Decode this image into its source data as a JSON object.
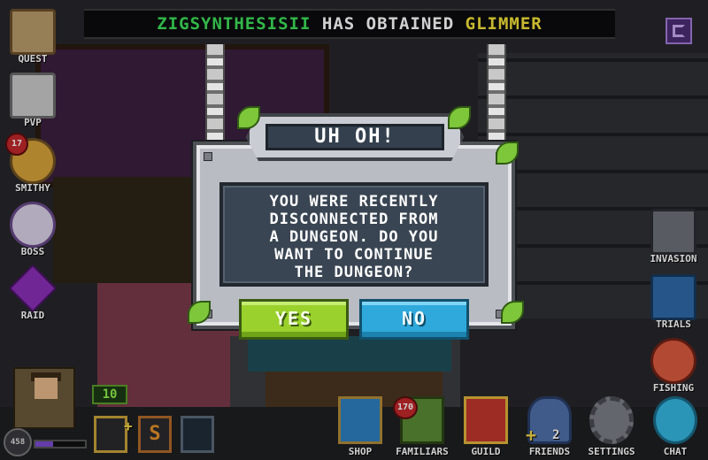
{
  "banner": {
    "player": "ZIGSYNTHESISII",
    "middle": "HAS OBTAINED",
    "item": "GLIMMER"
  },
  "left_menu": {
    "quest": "QUEST",
    "pvp": "PVP",
    "smithy": "SMITHY",
    "smithy_badge": "17",
    "boss": "BOSS",
    "raid": "RAID"
  },
  "right_menu": {
    "invasion": "INVASION",
    "trials": "TRIALS",
    "fishing": "FISHING"
  },
  "bottom_menu": {
    "shop": "SHOP",
    "familiars": "FAMILIARS",
    "familiars_badge": "170",
    "guild": "GUILD",
    "friends": "FRIENDS",
    "friends_count": "2",
    "settings": "SETTINGS",
    "chat": "CHAT"
  },
  "player": {
    "level": "458",
    "energy": "10",
    "slot_s": "S"
  },
  "dialog": {
    "title": "UH OH!",
    "message": "YOU WERE RECENTLY\nDISCONNECTED FROM\nA DUNGEON. DO YOU\nWANT TO CONTINUE\nTHE DUNGEON?",
    "yes_label": "YES",
    "no_label": "NO"
  },
  "icons": [
    "quest-scroll-icon",
    "pvp-swords-icon",
    "smithy-anvil-icon",
    "boss-icon",
    "raid-crystal-icon",
    "invasion-icon",
    "trials-icon",
    "fishing-icon",
    "shop-icon",
    "familiars-icon",
    "guild-icon",
    "friends-icon",
    "settings-gear-icon",
    "chat-bubble-icon",
    "menu-icon"
  ],
  "colors": {
    "player_name": "#3de05a",
    "item_name": "#f4e23a",
    "yes_button": "#9ad12c",
    "no_button": "#2fa9dc",
    "badge": "#c0282a"
  }
}
